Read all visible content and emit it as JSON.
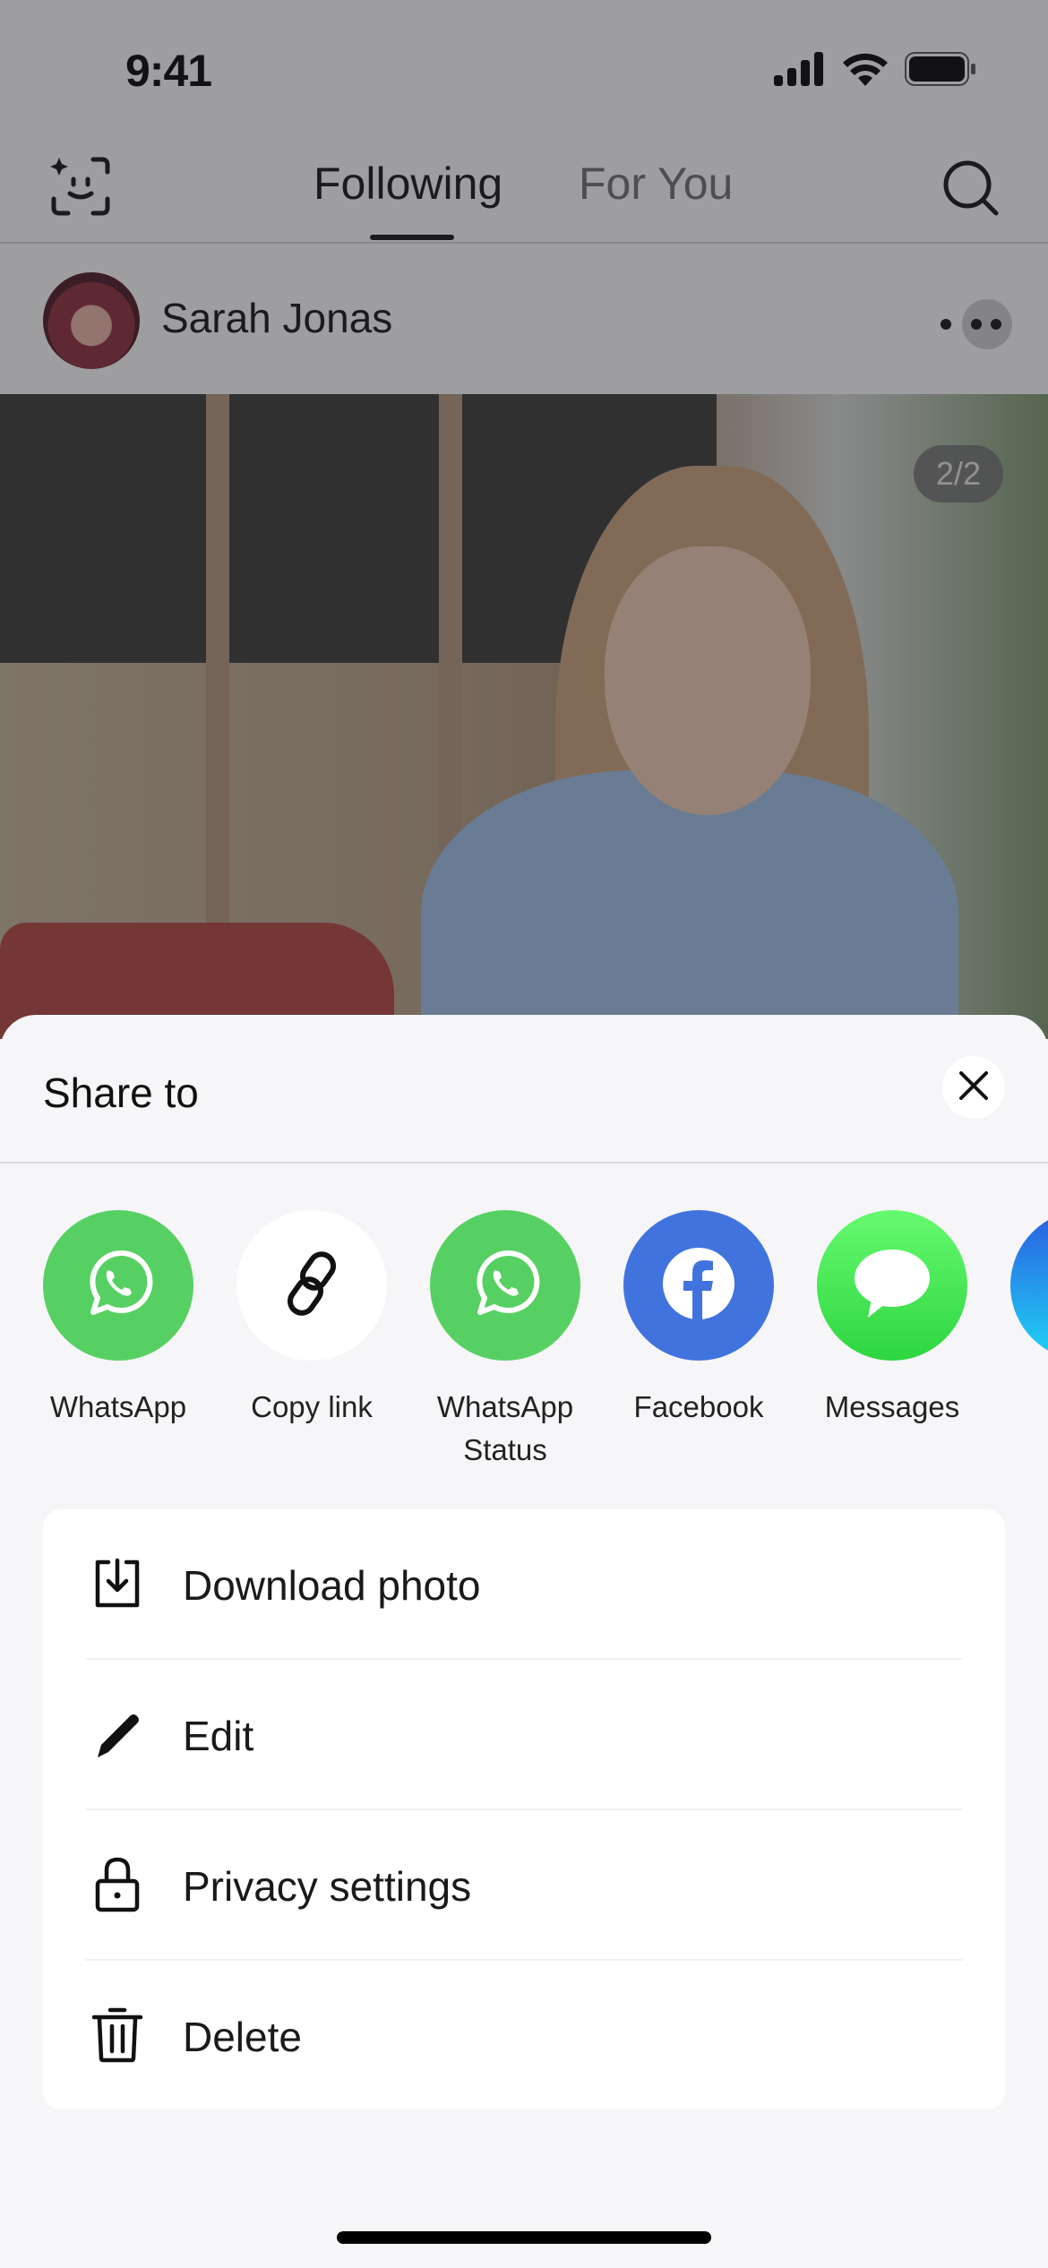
{
  "status_bar": {
    "time": "9:41",
    "icons": [
      "cellular-signal-icon",
      "wifi-icon",
      "battery-icon"
    ]
  },
  "top_nav": {
    "left_icon": "face-scan-sparkle-icon",
    "tabs": [
      {
        "label": "Following",
        "active": true
      },
      {
        "label": "For You",
        "active": false
      }
    ],
    "right_icon": "search-icon"
  },
  "post": {
    "author_name": "Sarah Jonas",
    "more_icon": "more-options-icon",
    "page_indicator": "2/2"
  },
  "share_sheet": {
    "title": "Share to",
    "close_icon": "close-icon",
    "targets": [
      {
        "label": "WhatsApp",
        "icon": "whatsapp-icon",
        "color": "#56d062"
      },
      {
        "label": "Copy link",
        "icon": "link-icon",
        "color": "#ffffff"
      },
      {
        "label": "WhatsApp Status",
        "label_line1": "WhatsApp",
        "label_line2": "Status",
        "icon": "whatsapp-icon",
        "color": "#56d062"
      },
      {
        "label": "Facebook",
        "icon": "facebook-icon",
        "color": "#4173de"
      },
      {
        "label": "Messages",
        "icon": "messages-icon",
        "color": "#4cd964"
      },
      {
        "label": "",
        "icon": "partial-app-icon",
        "color": "#1fa3f0"
      }
    ],
    "actions": [
      {
        "label": "Download photo",
        "icon": "download-icon"
      },
      {
        "label": "Edit",
        "icon": "pencil-icon"
      },
      {
        "label": "Privacy settings",
        "icon": "lock-icon"
      },
      {
        "label": "Delete",
        "icon": "trash-icon"
      }
    ]
  }
}
